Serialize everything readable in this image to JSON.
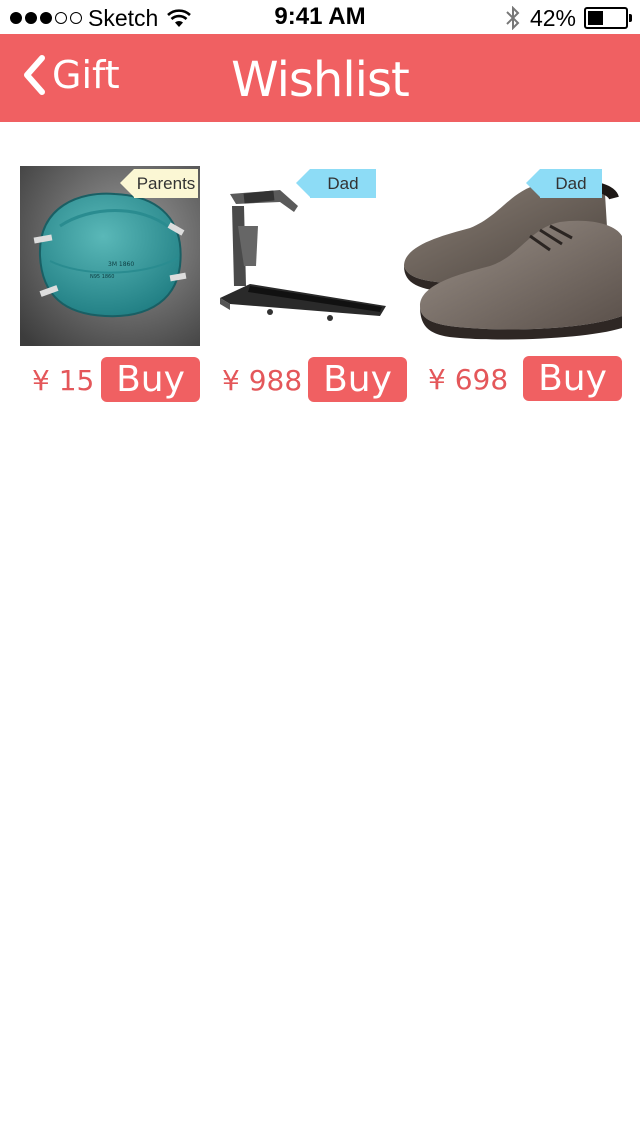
{
  "status_bar": {
    "carrier": "Sketch",
    "time": "9:41 AM",
    "battery": "42%",
    "battery_level": 0.42
  },
  "nav": {
    "back_label": "Gift",
    "title": "Wishlist",
    "color": "#f06062"
  },
  "products": [
    {
      "name": "face mask",
      "tag": "Parents",
      "tag_color": "#fbf7d4",
      "price": "¥ 15",
      "buy_label": "Buy"
    },
    {
      "name": "treadmill",
      "tag": "Dad",
      "tag_color": "#8ddcf6",
      "price": "¥ 988",
      "buy_label": "Buy"
    },
    {
      "name": "shoes",
      "tag": "Dad",
      "tag_color": "#8ddcf6",
      "price": "¥ 698",
      "buy_label": "Buy"
    }
  ]
}
